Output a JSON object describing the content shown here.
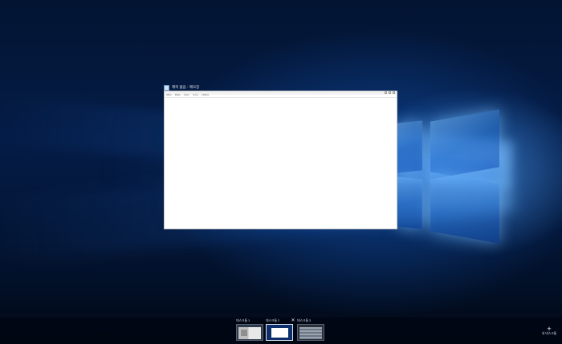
{
  "window": {
    "title": "제목 없음 - 메모장",
    "menu": [
      "파일(F)",
      "편집(E)",
      "서식(O)",
      "보기(V)",
      "도움말(H)"
    ]
  },
  "task_view": {
    "desktops": [
      {
        "label": "데스크톱 1",
        "selected": false
      },
      {
        "label": "데스크톱 2",
        "selected": true
      },
      {
        "label": "데스크톱 3",
        "selected": false
      }
    ],
    "close_glyph": "✕",
    "new_desktop": {
      "plus": "+",
      "label": "새 데스크톱"
    }
  },
  "colors": {
    "wallpaper_base": "#031432",
    "accent_light": "#78beff",
    "taskbar": "#000612"
  },
  "icons": [
    "notepad-icon",
    "close-icon",
    "plus-icon"
  ]
}
